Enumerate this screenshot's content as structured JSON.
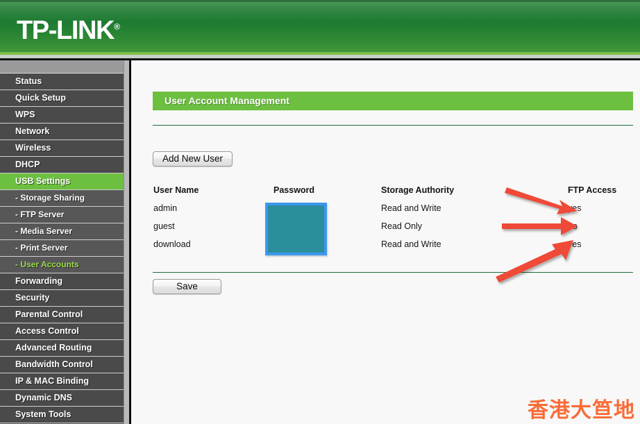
{
  "header": {
    "brand": "TP-LINK",
    "brand_registered": "®"
  },
  "sidebar": {
    "items": [
      {
        "label": "Status",
        "type": "top",
        "state": "normal"
      },
      {
        "label": "Quick Setup",
        "type": "top",
        "state": "normal"
      },
      {
        "label": "WPS",
        "type": "top",
        "state": "normal"
      },
      {
        "label": "Network",
        "type": "top",
        "state": "normal"
      },
      {
        "label": "Wireless",
        "type": "top",
        "state": "normal"
      },
      {
        "label": "DHCP",
        "type": "top",
        "state": "normal"
      },
      {
        "label": "USB Settings",
        "type": "top",
        "state": "active"
      },
      {
        "label": "- Storage Sharing",
        "type": "sub",
        "state": "normal"
      },
      {
        "label": "- FTP Server",
        "type": "sub",
        "state": "normal"
      },
      {
        "label": "- Media Server",
        "type": "sub",
        "state": "normal"
      },
      {
        "label": "- Print Server",
        "type": "sub",
        "state": "normal"
      },
      {
        "label": "- User Accounts",
        "type": "sub",
        "state": "selected"
      },
      {
        "label": "Forwarding",
        "type": "top",
        "state": "normal"
      },
      {
        "label": "Security",
        "type": "top",
        "state": "normal"
      },
      {
        "label": "Parental Control",
        "type": "top",
        "state": "normal"
      },
      {
        "label": "Access Control",
        "type": "top",
        "state": "normal"
      },
      {
        "label": "Advanced Routing",
        "type": "top",
        "state": "normal"
      },
      {
        "label": "Bandwidth Control",
        "type": "top",
        "state": "normal"
      },
      {
        "label": "IP & MAC Binding",
        "type": "top",
        "state": "normal"
      },
      {
        "label": "Dynamic DNS",
        "type": "top",
        "state": "normal"
      },
      {
        "label": "System Tools",
        "type": "top",
        "state": "normal"
      }
    ]
  },
  "main": {
    "page_title": "User Account Management",
    "add_new_user_label": "Add New User",
    "save_label": "Save",
    "table": {
      "headers": {
        "user_name": "User Name",
        "password": "Password",
        "storage_authority": "Storage Authority",
        "ftp_access": "FTP Access"
      },
      "rows": [
        {
          "user_name": "admin",
          "password": "",
          "storage_authority": "Read and Write",
          "ftp_access": "yes"
        },
        {
          "user_name": "guest",
          "password": "",
          "storage_authority": "Read Only",
          "ftp_access": "no"
        },
        {
          "user_name": "download",
          "password": "",
          "storage_authority": "Read and Write",
          "ftp_access": "yes"
        }
      ]
    },
    "password_redaction": {
      "fill_color": "#2a8e9c",
      "border_color": "#3d97ef"
    }
  },
  "annotations": {
    "arrow_color": "#ef4a38",
    "arrows": [
      {
        "name": "arrow-to-admin-ftp",
        "points_to": "yes"
      },
      {
        "name": "arrow-to-guest-ftp",
        "points_to": "no"
      },
      {
        "name": "arrow-to-download-ftp",
        "points_to": "yes"
      }
    ]
  },
  "watermark": {
    "text": "香港大笪地",
    "color": "#f96c38"
  },
  "theme": {
    "brand_green": "#6cbf3f",
    "header_green_dark": "#1d7a31",
    "sidebar_gray": "#4a4a4a",
    "sidebar_sub_gray": "#575757"
  }
}
